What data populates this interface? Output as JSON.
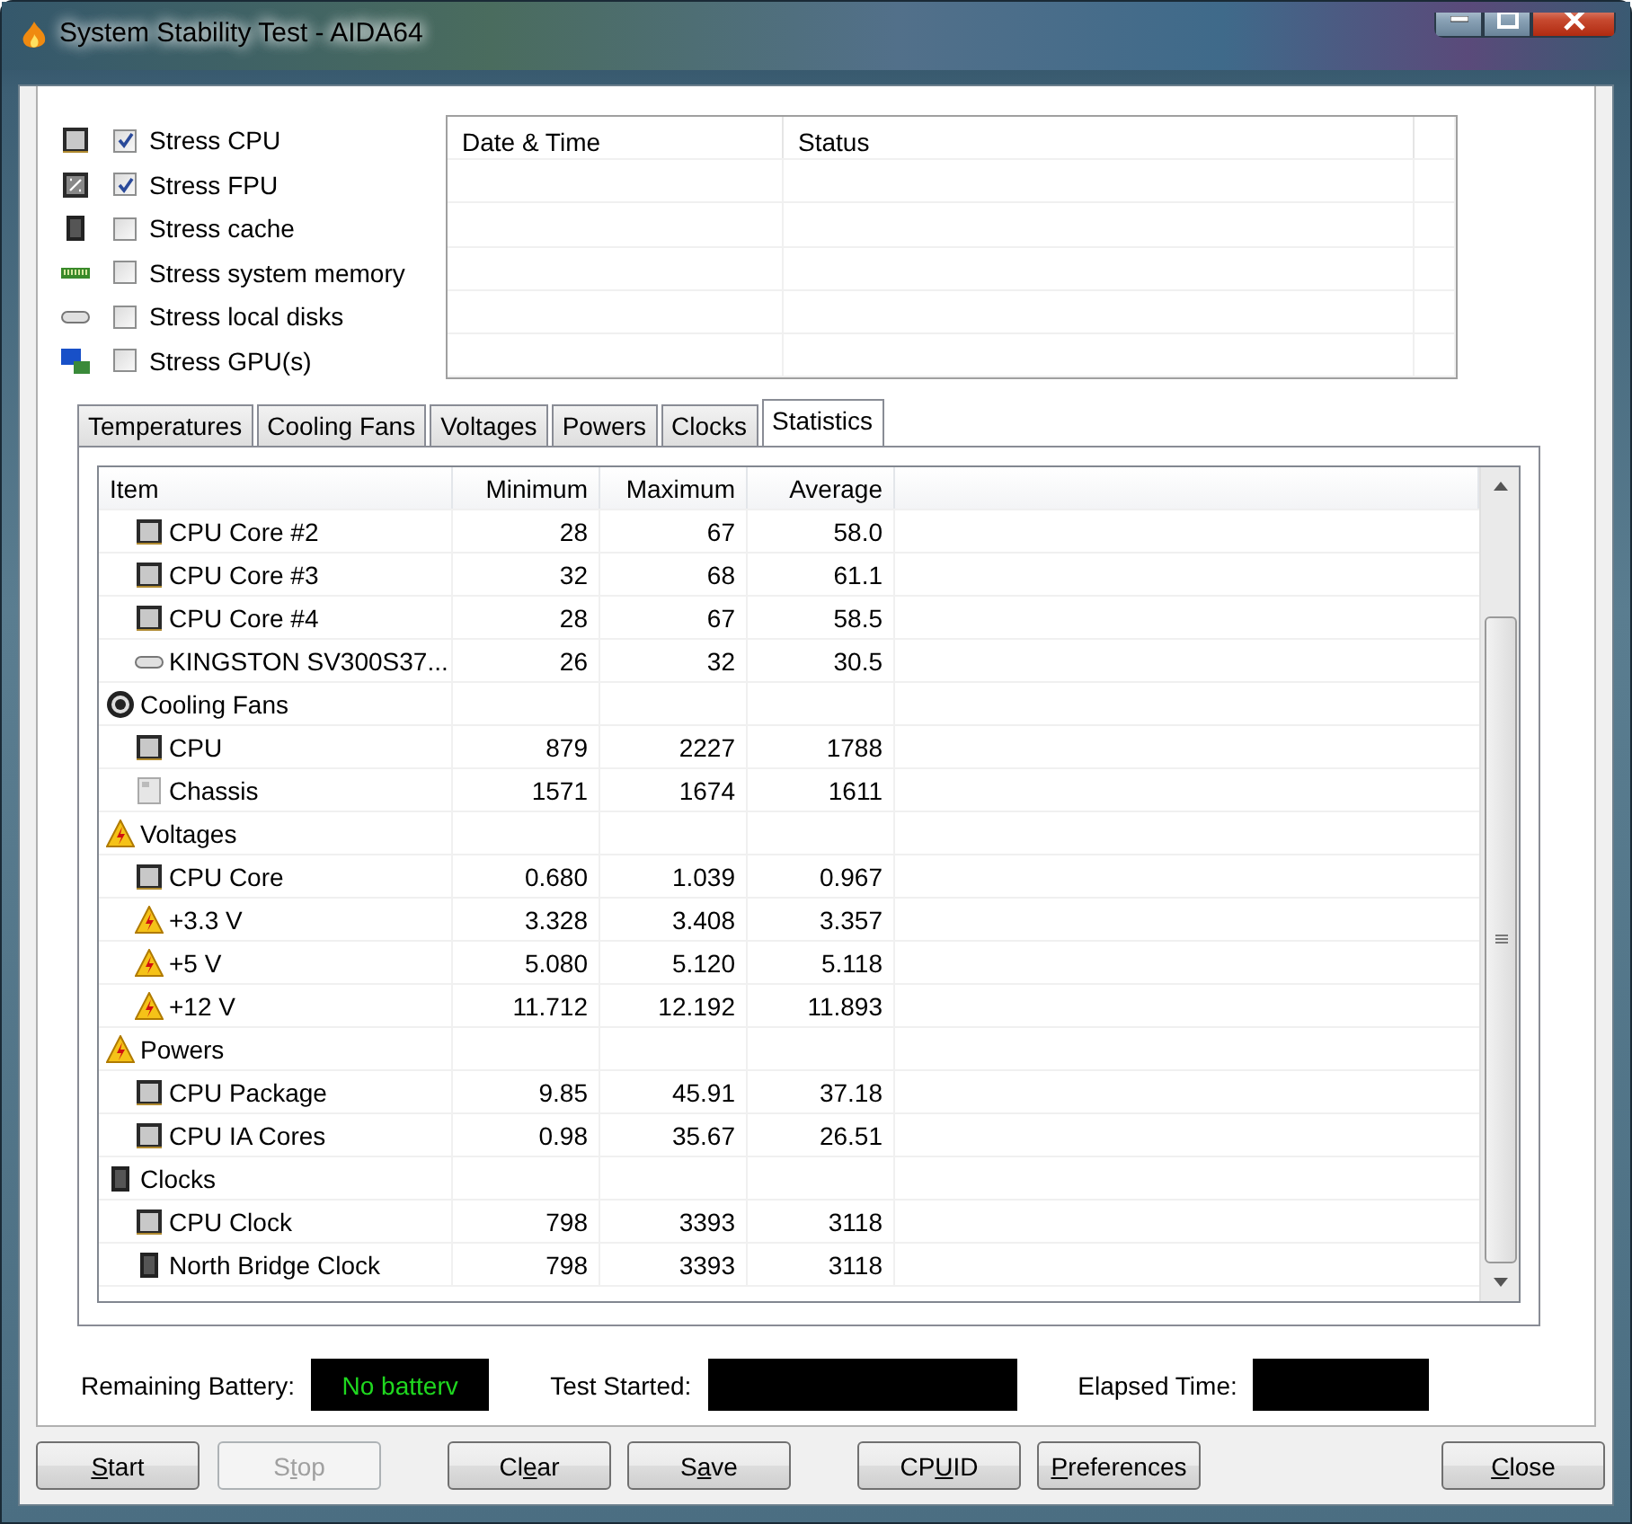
{
  "window": {
    "title": "System Stability Test - AIDA64"
  },
  "stress_options": [
    {
      "label": "Stress CPU",
      "kind": "cpu",
      "checked": true
    },
    {
      "label": "Stress FPU",
      "kind": "fpu",
      "checked": true
    },
    {
      "label": "Stress cache",
      "kind": "cache",
      "checked": false
    },
    {
      "label": "Stress system memory",
      "kind": "memory",
      "checked": false
    },
    {
      "label": "Stress local disks",
      "kind": "disk",
      "checked": false
    },
    {
      "label": "Stress GPU(s)",
      "kind": "gpu",
      "checked": false
    }
  ],
  "log_table": {
    "columns": [
      "Date & Time",
      "Status"
    ]
  },
  "tabs": [
    {
      "label": "Temperatures",
      "selected": false
    },
    {
      "label": "Cooling Fans",
      "selected": false
    },
    {
      "label": "Voltages",
      "selected": false
    },
    {
      "label": "Powers",
      "selected": false
    },
    {
      "label": "Clocks",
      "selected": false
    },
    {
      "label": "Statistics",
      "selected": true
    }
  ],
  "statistics": {
    "columns": [
      "Item",
      "Minimum",
      "Maximum",
      "Average"
    ],
    "groups": [
      {
        "children": [
          {
            "name": "CPU Core #2",
            "kind": "cpu",
            "min": "28",
            "max": "67",
            "avg": "58.0"
          },
          {
            "name": "CPU Core #3",
            "kind": "cpu",
            "min": "32",
            "max": "68",
            "avg": "61.1"
          },
          {
            "name": "CPU Core #4",
            "kind": "cpu",
            "min": "28",
            "max": "67",
            "avg": "58.5"
          },
          {
            "name": "KINGSTON SV300S37...",
            "kind": "disk",
            "min": "26",
            "max": "32",
            "avg": "30.5"
          }
        ]
      },
      {
        "label": "Cooling Fans",
        "kind": "fan",
        "children": [
          {
            "name": "CPU",
            "kind": "cpu",
            "min": "879",
            "max": "2227",
            "avg": "1788"
          },
          {
            "name": "Chassis",
            "kind": "case",
            "min": "1571",
            "max": "1674",
            "avg": "1611"
          }
        ]
      },
      {
        "label": "Voltages",
        "kind": "warning",
        "children": [
          {
            "name": "CPU Core",
            "kind": "cpu",
            "min": "0.680",
            "max": "1.039",
            "avg": "0.967"
          },
          {
            "name": "+3.3 V",
            "kind": "warning",
            "min": "3.328",
            "max": "3.408",
            "avg": "3.357"
          },
          {
            "name": "+5 V",
            "kind": "warning",
            "min": "5.080",
            "max": "5.120",
            "avg": "5.118"
          },
          {
            "name": "+12 V",
            "kind": "warning",
            "min": "11.712",
            "max": "12.192",
            "avg": "11.893"
          }
        ]
      },
      {
        "label": "Powers",
        "kind": "warning",
        "children": [
          {
            "name": "CPU Package",
            "kind": "cpu",
            "min": "9.85",
            "max": "45.91",
            "avg": "37.18"
          },
          {
            "name": "CPU IA Cores",
            "kind": "cpu",
            "min": "0.98",
            "max": "35.67",
            "avg": "26.51"
          }
        ]
      },
      {
        "label": "Clocks",
        "kind": "cache",
        "children": [
          {
            "name": "CPU Clock",
            "kind": "cpu",
            "min": "798",
            "max": "3393",
            "avg": "3118"
          },
          {
            "name": "North Bridge Clock",
            "kind": "cache",
            "min": "798",
            "max": "3393",
            "avg": "3118"
          }
        ]
      }
    ]
  },
  "status": {
    "battery_label": "Remaining Battery:",
    "battery_value": "No batterv",
    "started_label": "Test Started:",
    "elapsed_label": "Elapsed Time:"
  },
  "buttons": [
    {
      "key": "S",
      "after": "tart",
      "disabled": false
    },
    {
      "before": "S",
      "key": "t",
      "after": "op",
      "disabled": true
    },
    {
      "before": "Cl",
      "key": "e",
      "after": "ar",
      "disabled": false
    },
    {
      "before": "S",
      "key": "a",
      "after": "ve",
      "disabled": false
    },
    {
      "before": "CP",
      "key": "U",
      "after": "ID",
      "disabled": false
    },
    {
      "key": "P",
      "after": "references",
      "disabled": false
    },
    {
      "key": "C",
      "after": "lose",
      "disabled": false
    }
  ]
}
